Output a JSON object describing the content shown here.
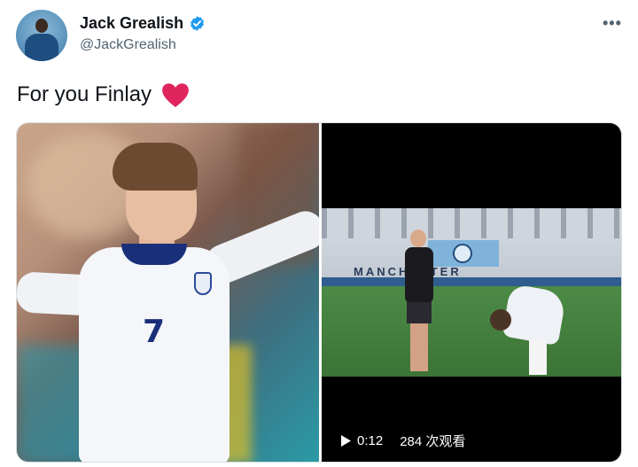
{
  "author": {
    "display_name": "Jack Grealish",
    "handle": "@JackGrealish",
    "verified": true
  },
  "menu": {
    "more_label": "•••"
  },
  "tweet": {
    "text": "For you Finlay",
    "emoji": "red-heart"
  },
  "video": {
    "duration": "0:12",
    "views": "284 次观看",
    "wall_text": "MANCHESTER"
  },
  "photo": {
    "shirt_number": "7"
  },
  "colors": {
    "verified_blue": "#1d9bf0",
    "heart_red": "#e0245e",
    "handle_gray": "#536471"
  }
}
